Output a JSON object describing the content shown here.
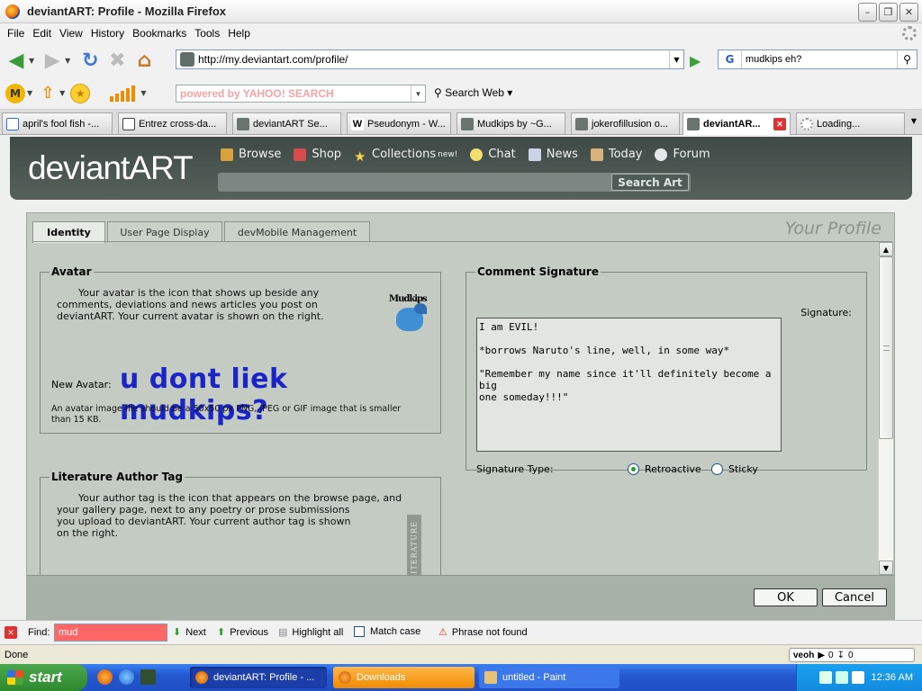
{
  "window": {
    "title": "deviantART: Profile - Mozilla Firefox"
  },
  "menu": [
    "File",
    "Edit",
    "View",
    "History",
    "Bookmarks",
    "Tools",
    "Help"
  ],
  "nav": {
    "url": "http://my.deviantart.com/profile/",
    "search_engine": "G",
    "search_value": "mudkips eh?"
  },
  "toolbar2": {
    "yahoo_placeholder": "powered by YAHOO! SEARCH",
    "search_web": "Search Web"
  },
  "tabs": [
    "april's fool fish -...",
    "Entrez cross-da...",
    "deviantART Se...",
    "Pseudonym - W...",
    "Mudkips by ~G...",
    "jokerofillusion o...",
    "deviantAR...",
    "Loading..."
  ],
  "da": {
    "logo": "deviantART",
    "nav": [
      "Browse",
      "Shop",
      "Collections",
      "Chat",
      "News",
      "Today",
      "Forum"
    ],
    "collections_badge": "new!",
    "search_button": "Search Art"
  },
  "panel": {
    "tabs": [
      "Identity",
      "User Page Display",
      "devMobile Management"
    ],
    "title": "Your Profile",
    "avatar": {
      "legend": "Avatar",
      "intro_1": "Your avatar is the icon that shows up beside any",
      "intro_2": "comments, deviations and news articles you post on",
      "intro_3": "deviantART. Your current avatar is shown on the right.",
      "image_caption": "Mudkips",
      "new_label": "New Avatar:",
      "new_value": "u dont liek mudkips?",
      "note_1": "An avatar image file should be a 50x50 px PNG, JPEG or GIF image that is smaller",
      "note_2": "than 15 KB."
    },
    "literature": {
      "legend": "Literature Author Tag",
      "text_1": "Your author tag is the icon that appears on the browse page, and",
      "text_2": "your gallery page, next to any poetry or prose submissions",
      "text_3": "you upload to deviantART. Your current author tag is shown",
      "text_4": "on the right.",
      "tag": "LITERATURE"
    },
    "signature": {
      "legend": "Comment Signature",
      "label": "Signature:",
      "text": "I am EVIL!\n\n*borrows Naruto's line, well, in some way*\n\n\"Remember my name since it'll definitely become a big\none someday!!!\"",
      "type_label": "Signature Type:",
      "options": [
        "Retroactive",
        "Sticky"
      ],
      "selected": "Retroactive"
    },
    "buttons": {
      "ok": "OK",
      "cancel": "Cancel"
    }
  },
  "findbar": {
    "label": "Find:",
    "value": "mud",
    "next": "Next",
    "previous": "Previous",
    "highlight": "Highlight all",
    "match_case": "Match case",
    "status": "Phrase not found"
  },
  "status": {
    "text": "Done",
    "veoh": "veoh",
    "count_a": "0",
    "count_b": "0"
  },
  "taskbar": {
    "start": "start",
    "tasks": [
      "deviantART: Profile - ...",
      "Downloads",
      "untitled - Paint"
    ],
    "clock": "12:36 AM"
  }
}
